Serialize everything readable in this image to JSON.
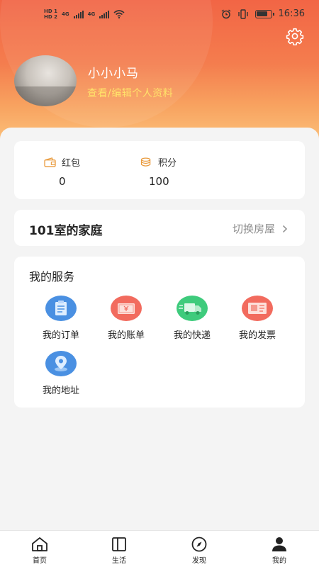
{
  "status_bar": {
    "sim1": "HD 1",
    "sim2": "HD 2",
    "net1": "4G",
    "net2": "4G",
    "time": "16:36"
  },
  "profile": {
    "username": "小小小马",
    "edit_link": "查看/编辑个人资料"
  },
  "assets": [
    {
      "icon": "wallet-icon",
      "label": "红包",
      "value": "0"
    },
    {
      "icon": "coins-icon",
      "label": "积分",
      "value": "100"
    }
  ],
  "home": {
    "title": "101室的家庭",
    "switch_label": "切换房屋"
  },
  "services": {
    "title": "我的服务",
    "items": [
      {
        "icon": "order-icon",
        "label": "我的订单",
        "color": "#4a90e2"
      },
      {
        "icon": "bill-icon",
        "label": "我的账单",
        "color": "#f26b5e"
      },
      {
        "icon": "delivery-truck-icon",
        "label": "我的快递",
        "color": "#3ecb7c"
      },
      {
        "icon": "invoice-icon",
        "label": "我的发票",
        "color": "#f26b5e"
      },
      {
        "icon": "location-pin-icon",
        "label": "我的地址",
        "color": "#4a90e2"
      }
    ]
  },
  "tabbar": {
    "items": [
      {
        "icon": "home-icon",
        "label": "首页"
      },
      {
        "icon": "book-icon",
        "label": "生活"
      },
      {
        "icon": "compass-icon",
        "label": "发现"
      },
      {
        "icon": "person-icon",
        "label": "我的"
      }
    ],
    "active_index": 3
  },
  "colors": {
    "header_gradient_top": "#f26545",
    "header_gradient_bottom": "#fbc07a",
    "edit_link": "#ffe36a",
    "asset_icon": "#e99a3c"
  }
}
